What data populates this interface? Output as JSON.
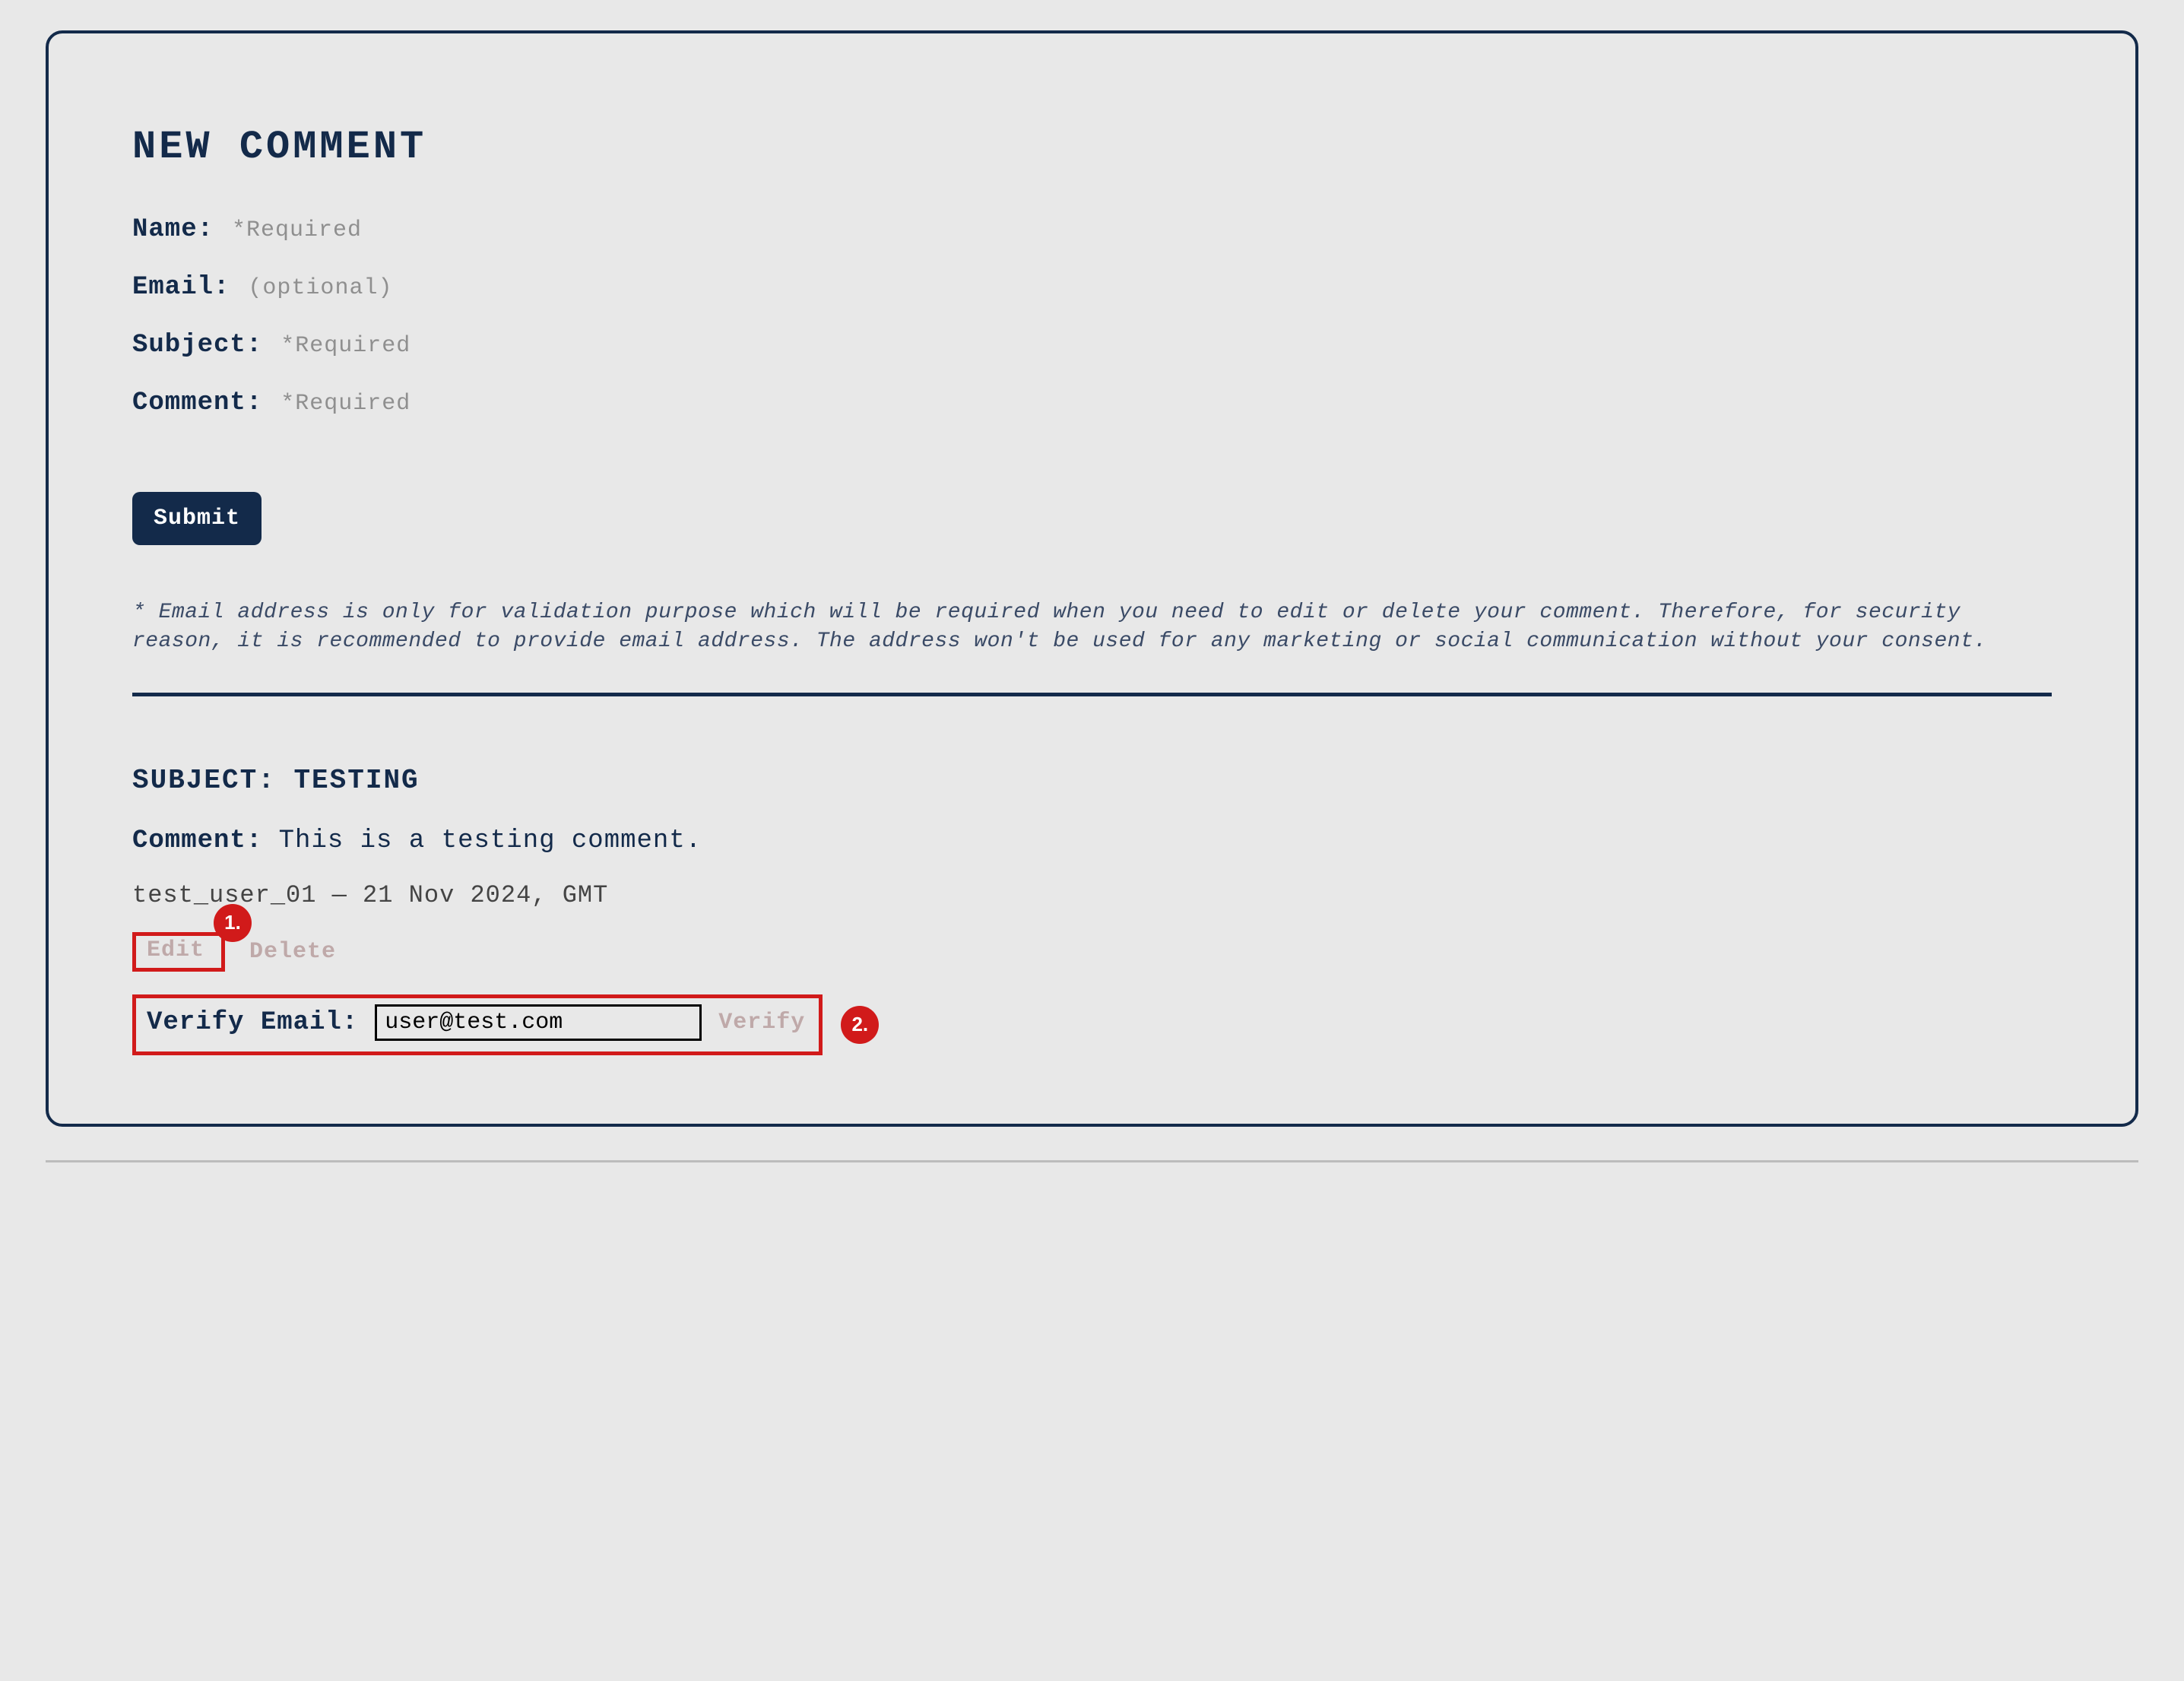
{
  "form": {
    "title": "NEW COMMENT",
    "fields": {
      "name": {
        "label": "Name:",
        "hint": "*Required"
      },
      "email": {
        "label": "Email:",
        "hint": "(optional)"
      },
      "subject": {
        "label": "Subject:",
        "hint": "*Required"
      },
      "comment": {
        "label": "Comment:",
        "hint": "*Required"
      }
    },
    "submit_label": "Submit",
    "disclaimer": "* Email address is only for validation purpose which will be required when you need to edit or delete your comment. Therefore, for security reason, it is recommended to provide email address. The address won't be used for any marketing or social communication without your consent."
  },
  "existing": {
    "subject_prefix": "SUBJECT:",
    "subject_value": "TESTING",
    "comment_label": "Comment:",
    "comment_value": "This is a testing comment.",
    "meta": "test_user_01 — 21 Nov 2024, GMT",
    "edit_label": "Edit",
    "delete_label": "Delete",
    "verify_label": "Verify Email:",
    "verify_value": "user@test.com",
    "verify_action": "Verify"
  },
  "callouts": {
    "one": "1.",
    "two": "2."
  }
}
